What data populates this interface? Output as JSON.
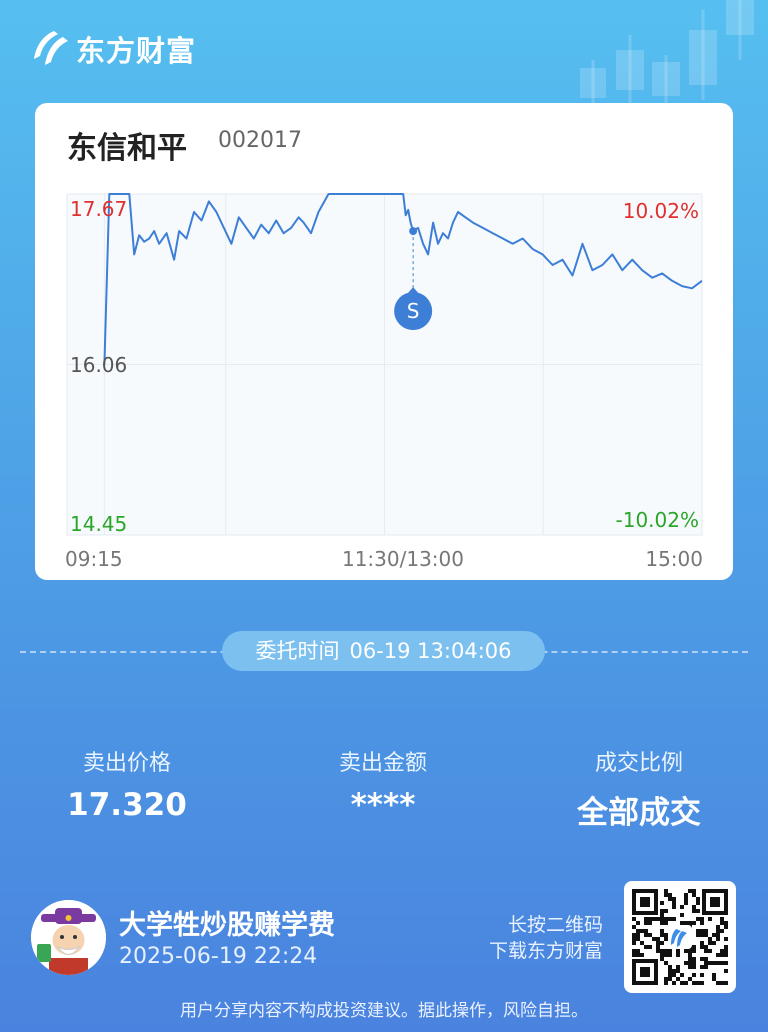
{
  "brand": {
    "name": "东方财富",
    "logo_icon": "flag-logo-icon"
  },
  "stock": {
    "name": "东信和平",
    "code": "002017"
  },
  "chart_data": {
    "type": "line",
    "title": "",
    "price_labels": {
      "high": "17.67",
      "mid": "16.06",
      "low": "14.45"
    },
    "pct_labels": {
      "high": "10.02%",
      "low": "-10.02%"
    },
    "x_ticks": [
      "09:15",
      "11:30/13:00",
      "15:00"
    ],
    "ylim": [
      14.45,
      17.67
    ],
    "marker": {
      "label": "S",
      "time": "13:04",
      "price": 17.32,
      "color": "#3d7fd6"
    },
    "series": [
      {
        "color": "#3d7fd6",
        "x": [
          "09:30",
          "09:32",
          "09:35",
          "09:37",
          "09:40",
          "09:42",
          "09:44",
          "09:46",
          "09:48",
          "09:50",
          "09:52",
          "09:55",
          "09:58",
          "10:00",
          "10:03",
          "10:06",
          "10:09",
          "10:12",
          "10:15",
          "10:18",
          "10:21",
          "10:24",
          "10:27",
          "10:30",
          "10:33",
          "10:36",
          "10:39",
          "10:42",
          "10:45",
          "10:48",
          "10:50",
          "10:53",
          "10:56",
          "11:00",
          "11:10",
          "11:20",
          "11:30",
          "13:00",
          "13:01",
          "13:02",
          "13:03",
          "13:04",
          "13:06",
          "13:08",
          "13:10",
          "13:12",
          "13:14",
          "13:16",
          "13:18",
          "13:20",
          "13:22",
          "13:25",
          "13:28",
          "13:32",
          "13:36",
          "13:40",
          "13:44",
          "13:48",
          "13:52",
          "13:56",
          "14:00",
          "14:04",
          "14:08",
          "14:12",
          "14:16",
          "14:20",
          "14:24",
          "14:28",
          "14:32",
          "14:36",
          "14:40",
          "14:44",
          "14:48",
          "14:52",
          "14:56",
          "15:00"
        ],
        "values": [
          16.06,
          17.67,
          17.67,
          17.67,
          17.67,
          17.1,
          17.28,
          17.22,
          17.25,
          17.32,
          17.2,
          17.3,
          17.05,
          17.32,
          17.25,
          17.5,
          17.42,
          17.6,
          17.5,
          17.35,
          17.2,
          17.45,
          17.35,
          17.25,
          17.38,
          17.3,
          17.42,
          17.3,
          17.35,
          17.45,
          17.4,
          17.3,
          17.5,
          17.67,
          17.67,
          17.67,
          17.67,
          17.67,
          17.47,
          17.52,
          17.4,
          17.32,
          17.35,
          17.2,
          17.1,
          17.4,
          17.2,
          17.3,
          17.25,
          17.4,
          17.5,
          17.45,
          17.4,
          17.35,
          17.3,
          17.25,
          17.2,
          17.25,
          17.15,
          17.1,
          17.0,
          17.05,
          16.9,
          17.2,
          16.95,
          17.0,
          17.1,
          16.95,
          17.05,
          16.95,
          16.88,
          16.92,
          16.85,
          16.8,
          16.78,
          16.85
        ]
      }
    ]
  },
  "order": {
    "label": "委托时间",
    "value": "06-19 13:04:06"
  },
  "stats": [
    {
      "label": "卖出价格",
      "value": "17.320"
    },
    {
      "label": "卖出金额",
      "value": "****"
    },
    {
      "label": "成交比例",
      "value": "全部成交"
    }
  ],
  "user": {
    "name": "大学牲炒股赚学费",
    "datetime": "2025-06-19 22:24"
  },
  "qr_hint": {
    "line1": "长按二维码",
    "line2": "下载东方财富"
  },
  "disclaimer": "用户分享内容不构成投资建议。据此操作，风险自担。",
  "colors": {
    "up": "#e0302e",
    "down": "#2aa62a",
    "line": "#3d7fd6"
  }
}
